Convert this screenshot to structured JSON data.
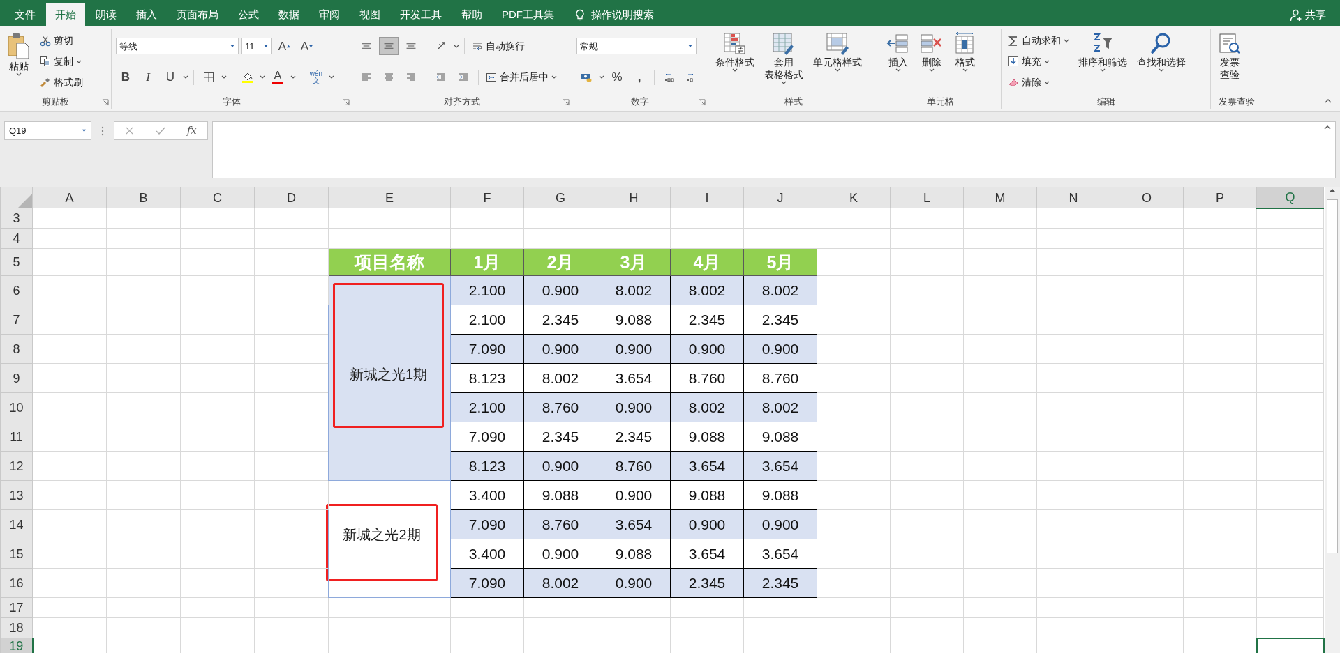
{
  "ribbon_tabs": [
    {
      "label": "文件",
      "selected": false
    },
    {
      "label": "开始",
      "selected": true
    },
    {
      "label": "朗读",
      "selected": false
    },
    {
      "label": "插入",
      "selected": false
    },
    {
      "label": "页面布局",
      "selected": false
    },
    {
      "label": "公式",
      "selected": false
    },
    {
      "label": "数据",
      "selected": false
    },
    {
      "label": "审阅",
      "selected": false
    },
    {
      "label": "视图",
      "selected": false
    },
    {
      "label": "开发工具",
      "selected": false
    },
    {
      "label": "帮助",
      "selected": false
    },
    {
      "label": "PDF工具集",
      "selected": false
    }
  ],
  "tell_me": "操作说明搜索",
  "share": "共享",
  "ribbon_groups": [
    {
      "kind": "clipboard",
      "title": "剪贴板",
      "launcher": true,
      "paste": "粘贴",
      "cut": "剪切",
      "copy": "复制",
      "format_painter": "格式刷"
    },
    {
      "kind": "font",
      "title": "字体",
      "launcher": true,
      "font_name": "等线",
      "font_size": "11",
      "grow_font": "A",
      "shrink_font": "A",
      "bold": "B",
      "italic": "I",
      "underline": "U",
      "font_color": "A",
      "phonetic": [
        "wén",
        "文"
      ]
    },
    {
      "kind": "alignment",
      "title": "对齐方式",
      "launcher": true,
      "vertical_align": [
        {
          "selected": false
        },
        {
          "selected": true
        },
        {
          "selected": false
        }
      ],
      "wrap_text": "自动换行",
      "merge_center": "合并后居中"
    },
    {
      "kind": "number",
      "title": "数字",
      "launcher": true,
      "format": "常规",
      "percent": "%",
      "comma": ","
    },
    {
      "kind": "styles",
      "title": "样式",
      "conditional": "条件格式",
      "table_format": [
        "套用",
        "表格格式"
      ],
      "cell_styles": "单元格样式"
    },
    {
      "kind": "cells",
      "title": "单元格",
      "insert": "插入",
      "delete": "删除",
      "format": "格式"
    },
    {
      "kind": "editing",
      "title": "编辑",
      "autosum": "自动求和",
      "fill": "填充",
      "clear": "清除",
      "sort_filter": "排序和筛选",
      "find_select": "查找和选择"
    },
    {
      "kind": "invoice",
      "title": "发票查验",
      "check": [
        "发票",
        "查验"
      ]
    }
  ],
  "formula_bar": {
    "name_box": "Q19",
    "fx": "fx"
  },
  "columns": [
    {
      "label": "A",
      "selected": false
    },
    {
      "label": "B",
      "selected": false
    },
    {
      "label": "C",
      "selected": false
    },
    {
      "label": "D",
      "selected": false
    },
    {
      "label": "E",
      "selected": false
    },
    {
      "label": "F",
      "selected": false
    },
    {
      "label": "G",
      "selected": false
    },
    {
      "label": "H",
      "selected": false
    },
    {
      "label": "I",
      "selected": false
    },
    {
      "label": "J",
      "selected": false
    },
    {
      "label": "K",
      "selected": false
    },
    {
      "label": "L",
      "selected": false
    },
    {
      "label": "M",
      "selected": false
    },
    {
      "label": "N",
      "selected": false
    },
    {
      "label": "O",
      "selected": false
    },
    {
      "label": "P",
      "selected": false
    },
    {
      "label": "Q",
      "selected": true
    }
  ],
  "rows": [
    {
      "label": "3",
      "selected": false
    },
    {
      "label": "4",
      "selected": false
    },
    {
      "label": "5",
      "selected": false
    },
    {
      "label": "6",
      "selected": false
    },
    {
      "label": "7",
      "selected": false
    },
    {
      "label": "8",
      "selected": false
    },
    {
      "label": "9",
      "selected": false
    },
    {
      "label": "10",
      "selected": false
    },
    {
      "label": "11",
      "selected": false
    },
    {
      "label": "12",
      "selected": false
    },
    {
      "label": "13",
      "selected": false
    },
    {
      "label": "14",
      "selected": false
    },
    {
      "label": "15",
      "selected": false
    },
    {
      "label": "16",
      "selected": false
    },
    {
      "label": "17",
      "selected": false
    },
    {
      "label": "18",
      "selected": false
    },
    {
      "label": "19",
      "selected": true
    }
  ],
  "table": {
    "headers": [
      "项目名称",
      "1月",
      "2月",
      "3月",
      "4月",
      "5月"
    ],
    "groups": [
      {
        "name": "新城之光1期",
        "highlighted": true,
        "rows": [
          [
            "2.100",
            "0.900",
            "8.002",
            "8.002",
            "8.002"
          ],
          [
            "2.100",
            "2.345",
            "9.088",
            "2.345",
            "2.345"
          ],
          [
            "7.090",
            "0.900",
            "0.900",
            "0.900",
            "0.900"
          ],
          [
            "8.123",
            "8.002",
            "3.654",
            "8.760",
            "8.760"
          ],
          [
            "2.100",
            "8.760",
            "0.900",
            "8.002",
            "8.002"
          ],
          [
            "7.090",
            "2.345",
            "2.345",
            "9.088",
            "9.088"
          ],
          [
            "8.123",
            "0.900",
            "8.760",
            "3.654",
            "3.654"
          ]
        ]
      },
      {
        "name": "新城之光2期",
        "highlighted": true,
        "rows": [
          [
            "3.400",
            "9.088",
            "0.900",
            "9.088",
            "9.088"
          ],
          [
            "7.090",
            "8.760",
            "3.654",
            "0.900",
            "0.900"
          ],
          [
            "3.400",
            "0.900",
            "9.088",
            "3.654",
            "3.654"
          ],
          [
            "7.090",
            "8.002",
            "0.900",
            "2.345",
            "2.345"
          ]
        ]
      }
    ]
  }
}
